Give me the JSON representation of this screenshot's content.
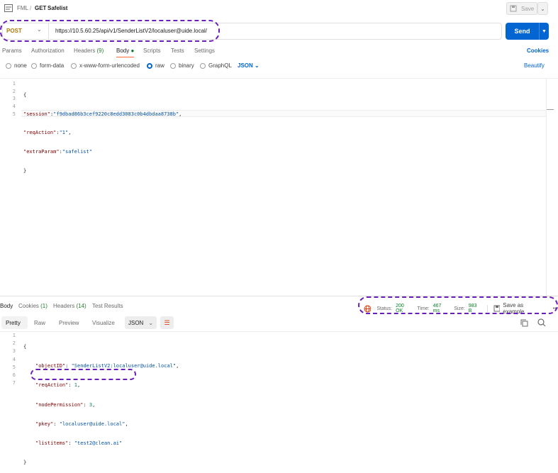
{
  "header": {
    "collection": "FML",
    "separator": "/",
    "method_badge": "GET",
    "request_name": "Safelist",
    "save_label": "Save"
  },
  "request": {
    "method": "POST",
    "url": "https://10.5.60.25/api/v1/SenderListV2/localuser@uide.local/",
    "send_label": "Send",
    "tabs": [
      "Params",
      "Authorization",
      "Headers",
      "Body",
      "Scripts",
      "Tests",
      "Settings"
    ],
    "headers_count": "(9)",
    "active_tab": "Body",
    "cookies_label": "Cookies",
    "body_types": [
      "none",
      "form-data",
      "x-www-form-urlencoded",
      "raw",
      "binary",
      "GraphQL"
    ],
    "selected_body_type": "raw",
    "format": "JSON",
    "beautify_label": "Beautify",
    "line_numbers": [
      "1",
      "2",
      "3",
      "4",
      "5"
    ],
    "body_lines": [
      {
        "punc_open": "{"
      },
      {
        "key": "\"session\"",
        "sep": ":",
        "value": "\"f9dbad86b3cef9220c8edd3083c0b4dbdaa8738b\"",
        "tail": ","
      },
      {
        "key": "\"reqAction\"",
        "sep": ":",
        "value": "\"1\"",
        "tail": ","
      },
      {
        "key": "\"extraParam\"",
        "sep": ":",
        "value": "\"safelist\"",
        "tail": ""
      },
      {
        "punc_close": "}"
      }
    ]
  },
  "response": {
    "tabs": [
      "Body",
      "Cookies",
      "Headers",
      "Test Results"
    ],
    "cookies_count": "(1)",
    "headers_count": "(14)",
    "status_label": "Status:",
    "status_value": "200 OK",
    "time_label": "Time:",
    "time_value": "467 ms",
    "size_label": "Size:",
    "size_value": "983 B",
    "save_example_label": "Save as example",
    "more_label": "•••",
    "view_tabs": [
      "Pretty",
      "Raw",
      "Preview",
      "Visualize"
    ],
    "format": "JSON",
    "line_numbers": [
      "1",
      "2",
      "3",
      "4",
      "5",
      "6",
      "7"
    ],
    "body_lines": [
      {
        "text": "{"
      },
      {
        "key": "\"objectID\"",
        "sep": ": ",
        "value": "\"SenderListV2:localuser@uide.local\"",
        "tail": ","
      },
      {
        "key": "\"reqAction\"",
        "sep": ": ",
        "value": "1",
        "tail": ","
      },
      {
        "key": "\"nodePermission\"",
        "sep": ": ",
        "value": "3",
        "tail": ","
      },
      {
        "key": "\"pkey\"",
        "sep": ": ",
        "value": "\"localuser@uide.local\"",
        "tail": ","
      },
      {
        "key": "\"listitems\"",
        "sep": ": ",
        "value": "\"test2@clean.ai\"",
        "tail": ""
      },
      {
        "text": "}"
      }
    ]
  },
  "colors": {
    "accent": "#0265d2",
    "annotation": "#6a1fb8",
    "method_post": "#ad7a03",
    "status_ok": "#067f23"
  }
}
